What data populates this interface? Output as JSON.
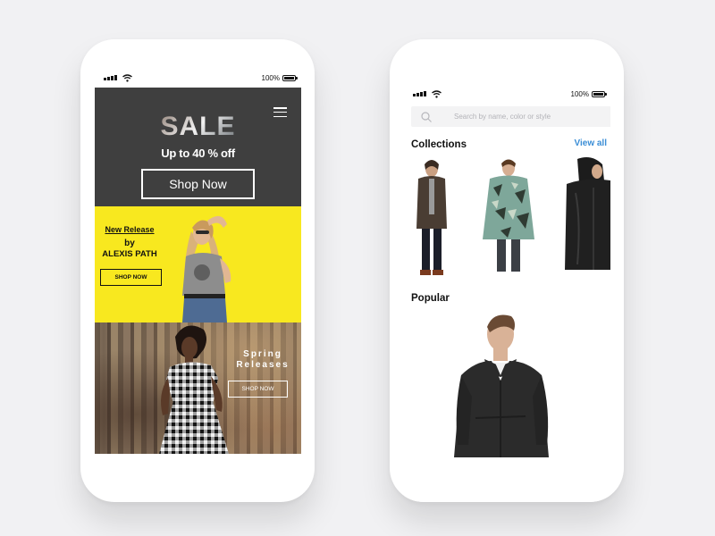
{
  "status_bar": {
    "battery": "100%"
  },
  "left_screen": {
    "hero": {
      "sale_title": "SALE",
      "subtitle": "Up to 40 % off",
      "cta_label": "Shop Now"
    },
    "new_release": {
      "heading": "New Release",
      "by": "by",
      "author": "ALEXIS PATH",
      "cta_label": "SHOP NOW",
      "background_color": "#f8e81f"
    },
    "spring": {
      "title_line1": "Spring",
      "title_line2": "Releases",
      "cta_label": "SHOP NOW"
    }
  },
  "right_screen": {
    "search": {
      "placeholder": "Search by name, color or style"
    },
    "collections": {
      "title": "Collections",
      "view_all_label": "View all"
    },
    "popular": {
      "title": "Popular"
    },
    "accent_color": "#3b8ed6"
  }
}
